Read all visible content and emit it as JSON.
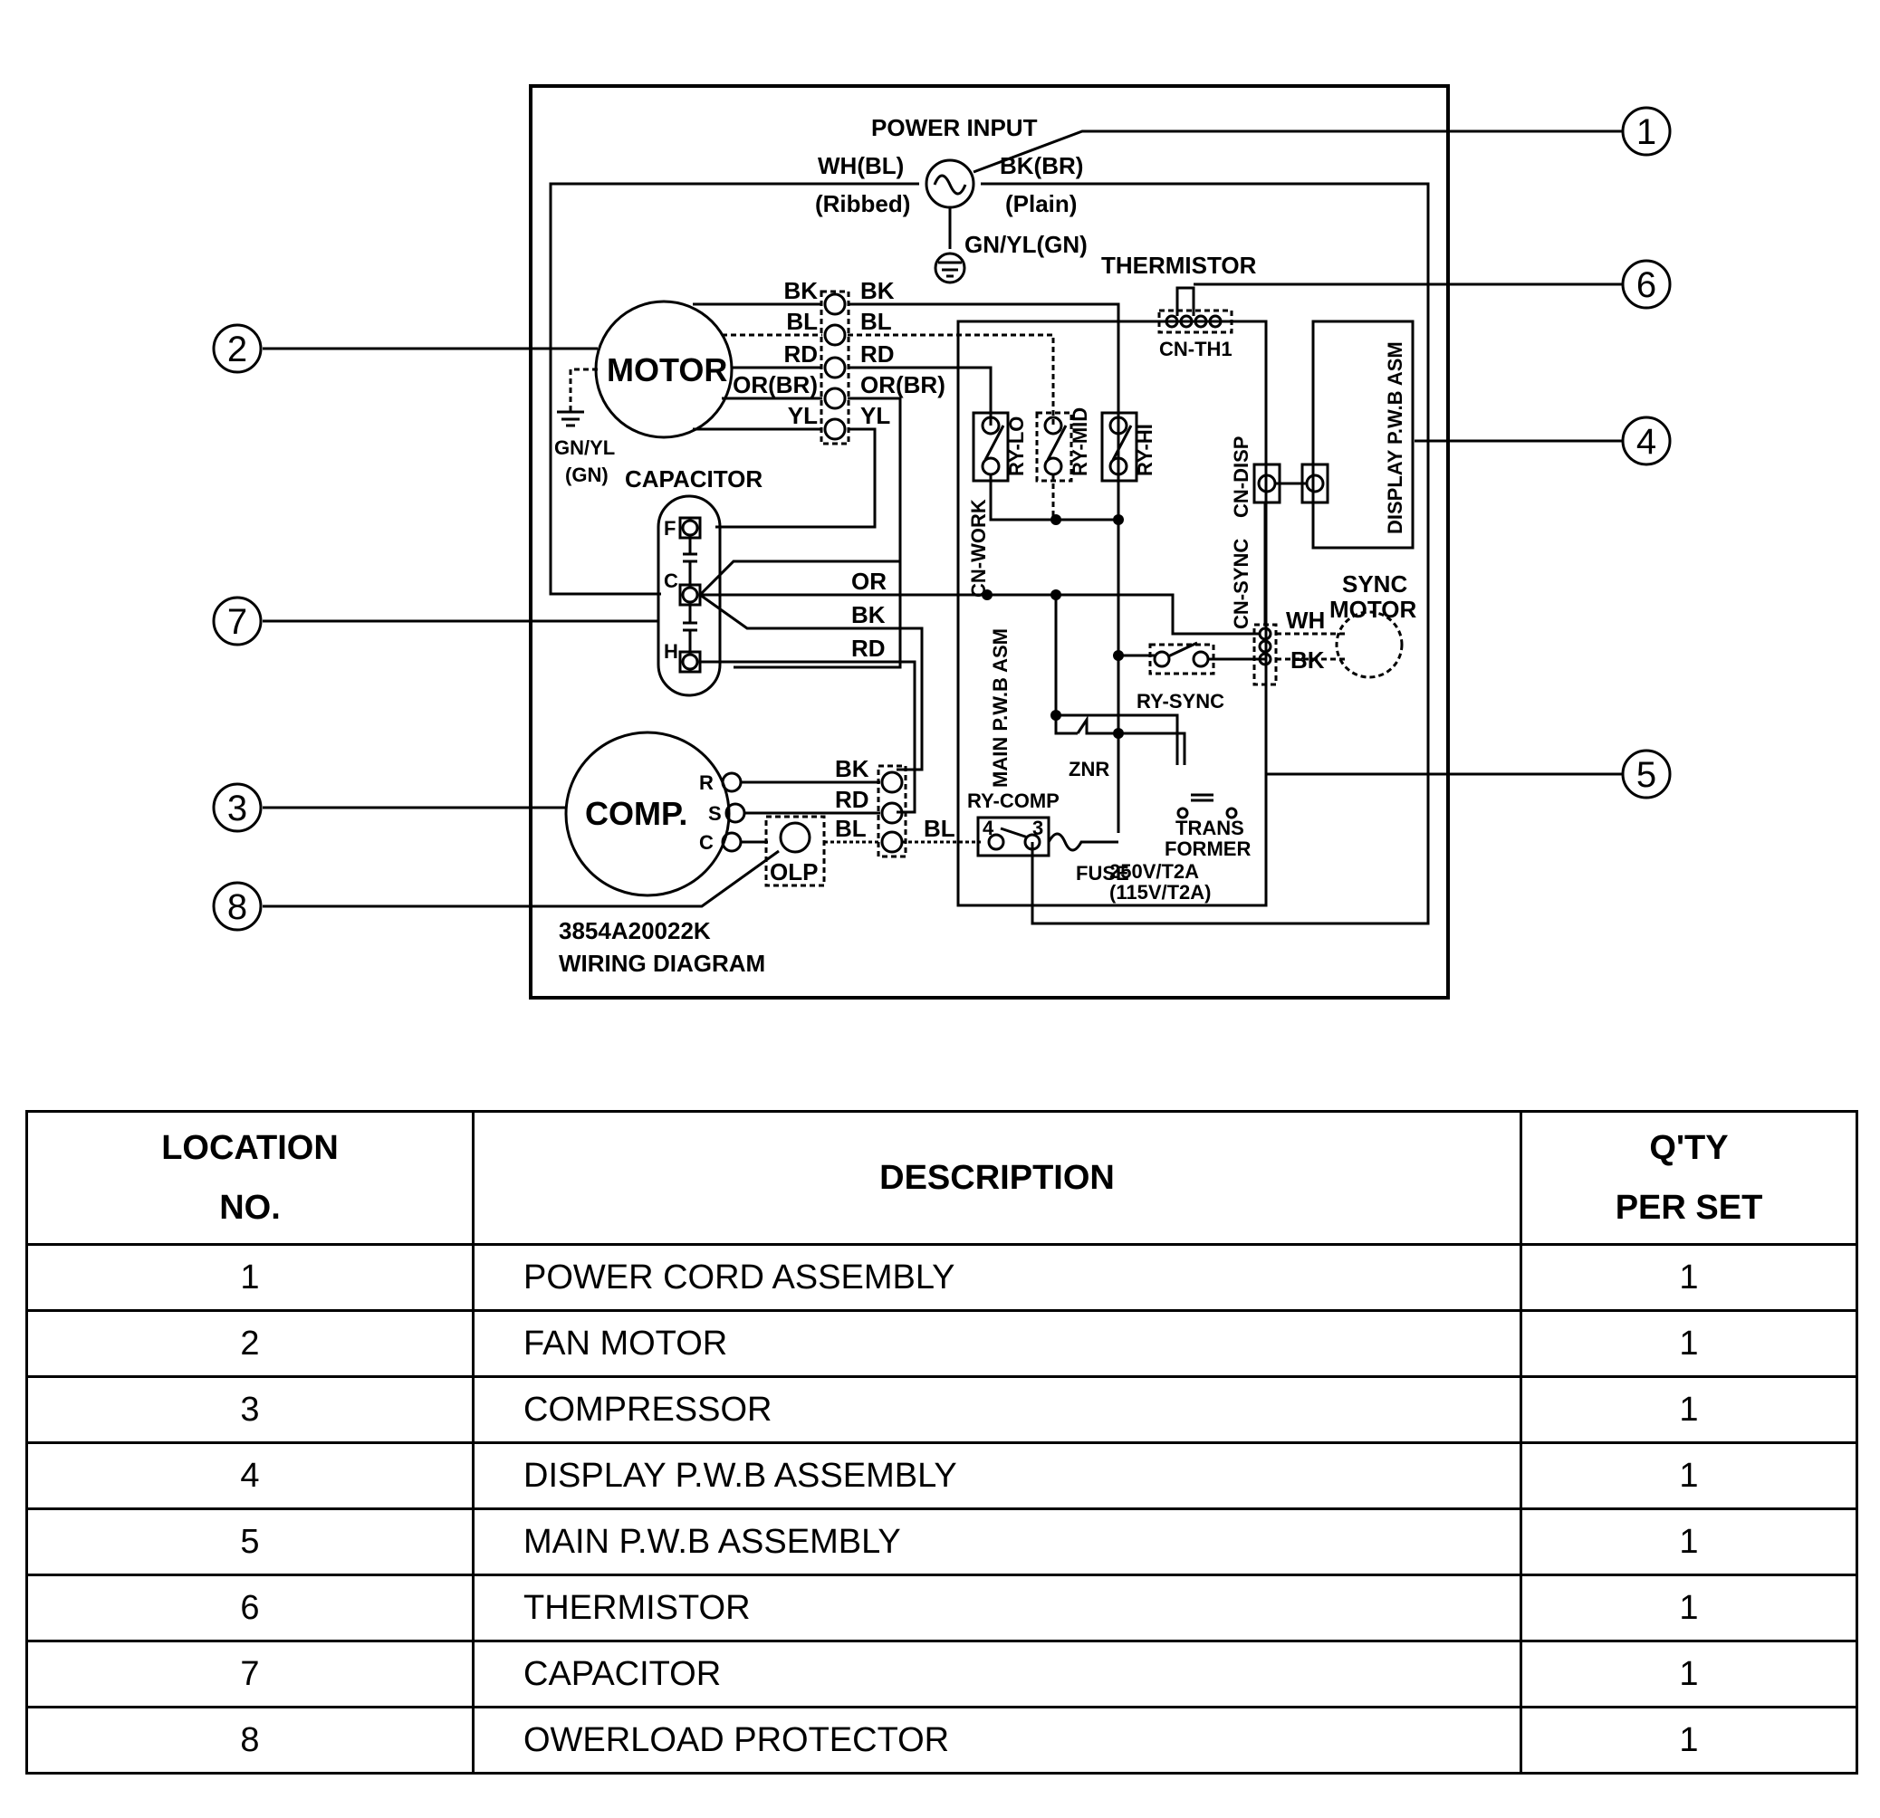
{
  "diagram": {
    "code": "3854A20022K",
    "title": "WIRING DIAGRAM",
    "power_input": {
      "label": "POWER INPUT",
      "left_wire": "WH(BL)",
      "left_wire_note": "(Ribbed)",
      "right_wire": "BK(BR)",
      "right_wire_note": "(Plain)",
      "ground_wire": "GN/YL(GN)"
    },
    "thermistor": {
      "label": "THERMISTOR",
      "connector": "CN-TH1"
    },
    "motor": {
      "label": "MOTOR",
      "ground_label_1": "GN/YL",
      "ground_label_2": "(GN)",
      "wires_left": [
        "BK",
        "BL",
        "RD",
        "OR(BR)",
        "YL"
      ],
      "wires_right": [
        "BK",
        "BL",
        "RD",
        "OR(BR)",
        "YL"
      ]
    },
    "capacitor": {
      "label": "CAPACITOR",
      "terminals": [
        "F",
        "C",
        "H"
      ],
      "wires": [
        "OR",
        "BK",
        "RD"
      ]
    },
    "relays": [
      "RY-LO",
      "RY-MID",
      "RY-HI"
    ],
    "connectors": {
      "work": "CN-WORK",
      "disp": "CN-DISP",
      "sync": "CN-SYNC"
    },
    "display_board": "DISPLAY P.W.B ASM",
    "main_board": "MAIN P.W.B ASM",
    "sync_motor": {
      "label_1": "SYNC",
      "label_2": "MOTOR",
      "wires": [
        "WH",
        "BK"
      ]
    },
    "ry_sync": "RY-SYNC",
    "znr": "ZNR",
    "transformer": {
      "label_1": "TRANS",
      "label_2": "FORMER"
    },
    "compressor": {
      "label": "COMP.",
      "terminals": [
        "R",
        "S",
        "C"
      ],
      "wires": [
        "BK",
        "RD",
        "BL"
      ],
      "bl_out": "BL"
    },
    "olp": "OLP",
    "ry_comp": {
      "label": "RY-COMP",
      "pin_left": "4",
      "pin_right": "3"
    },
    "fuse": {
      "label": "FUSE",
      "rating_1": "250V/T2A",
      "rating_2": "(115V/T2A)"
    },
    "callouts": [
      "1",
      "2",
      "3",
      "4",
      "5",
      "6",
      "7",
      "8"
    ]
  },
  "table": {
    "headers": {
      "location_1": "LOCATION",
      "location_2": "NO.",
      "description": "DESCRIPTION",
      "qty_1": "Q'TY",
      "qty_2": "PER SET"
    },
    "rows": [
      {
        "location": "1",
        "description": "POWER CORD ASSEMBLY",
        "qty": "1"
      },
      {
        "location": "2",
        "description": "FAN MOTOR",
        "qty": "1"
      },
      {
        "location": "3",
        "description": "COMPRESSOR",
        "qty": "1"
      },
      {
        "location": "4",
        "description": "DISPLAY P.W.B ASSEMBLY",
        "qty": "1"
      },
      {
        "location": "5",
        "description": "MAIN P.W.B ASSEMBLY",
        "qty": "1"
      },
      {
        "location": "6",
        "description": "THERMISTOR",
        "qty": "1"
      },
      {
        "location": "7",
        "description": "CAPACITOR",
        "qty": "1"
      },
      {
        "location": "8",
        "description": "OWERLOAD PROTECTOR",
        "qty": "1"
      }
    ]
  }
}
